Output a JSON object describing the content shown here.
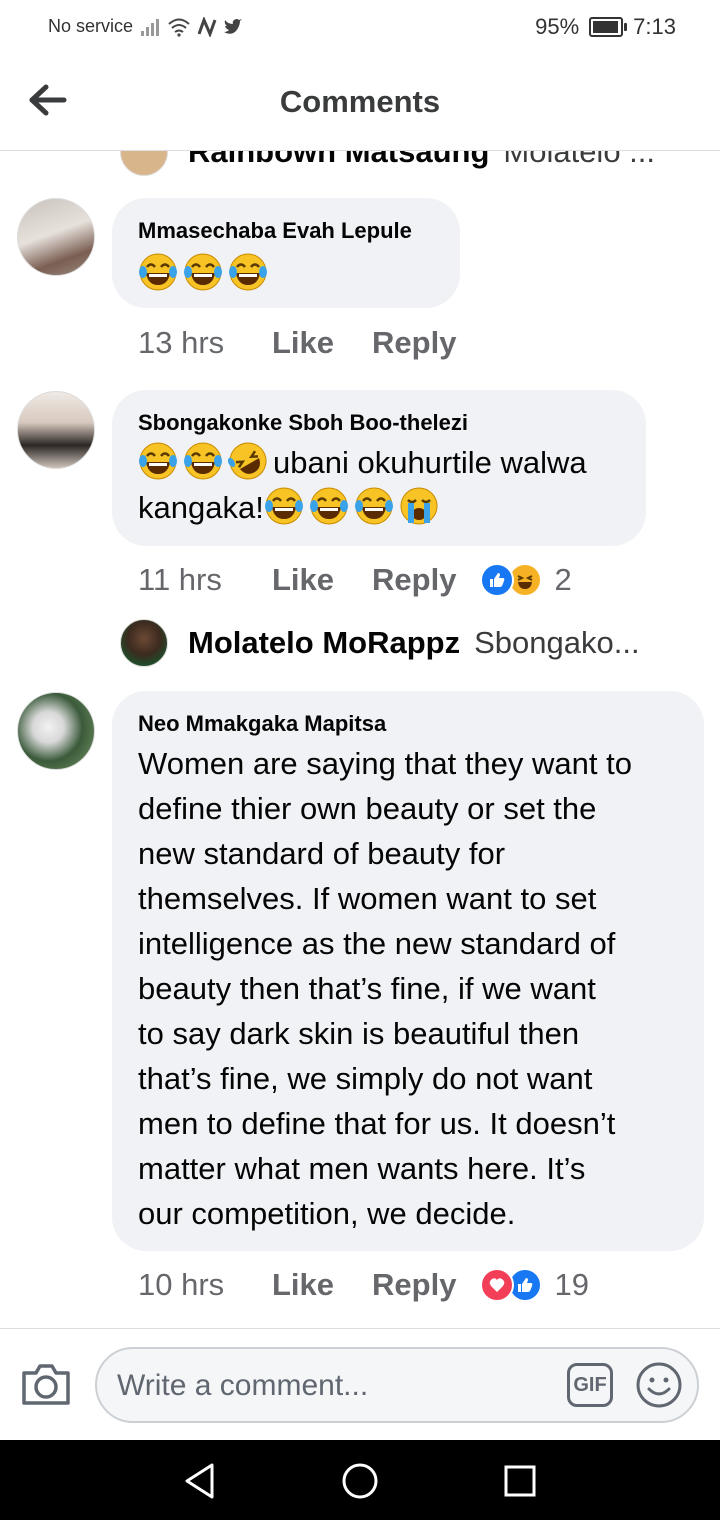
{
  "status_bar": {
    "carrier": "No service",
    "battery": "95%",
    "time": "7:13"
  },
  "header": {
    "title": "Comments"
  },
  "comments": [
    {
      "name": "Rainbown Matsaung",
      "text": "Molatelo ..."
    },
    {
      "name": "Mmasechaba Evah Lepule",
      "time": "13 hrs",
      "like": "Like",
      "reply": "Reply"
    },
    {
      "name": "Sbongakonke Sboh Boo-thelezi",
      "text_line1": "ubani okuhurtile walwa",
      "text_line2": "kangaka!",
      "time": "11 hrs",
      "like": "Like",
      "reply": "Reply",
      "reaction_count": "2",
      "reply_preview": {
        "name": "Molatelo MoRappz",
        "text": "Sbongako..."
      }
    },
    {
      "name": "Neo Mmakgaka Mapitsa",
      "lines": [
        "Women are saying that they want to",
        "define thier own beauty or set the",
        "new standard of beauty for",
        "themselves. If women want to set",
        "intelligence as the new standard of",
        "beauty then that’s fine, if we want",
        "to say dark skin is beautiful then",
        "that’s fine, we simply do not want",
        "men to define that for us. It doesn’t",
        "matter what men wants here. It’s",
        "our competition, we decide."
      ],
      "time": "10 hrs",
      "like": "Like",
      "reply": "Reply",
      "reaction_count": "19"
    }
  ],
  "composer": {
    "placeholder": "Write a comment...",
    "gif_label": "GIF"
  },
  "colors": {
    "bubble": "#f0f2f5",
    "secondary_text": "#65676b",
    "like_blue": "#1877f2",
    "love_red": "#f33e58",
    "haha_yellow": "#f7b125"
  },
  "icons": [
    "back-arrow-icon",
    "camera-icon",
    "gif-icon",
    "smiley-icon",
    "like-reaction-icon",
    "haha-reaction-icon",
    "love-reaction-icon",
    "nav-back-icon",
    "nav-home-icon",
    "nav-recents-icon"
  ]
}
